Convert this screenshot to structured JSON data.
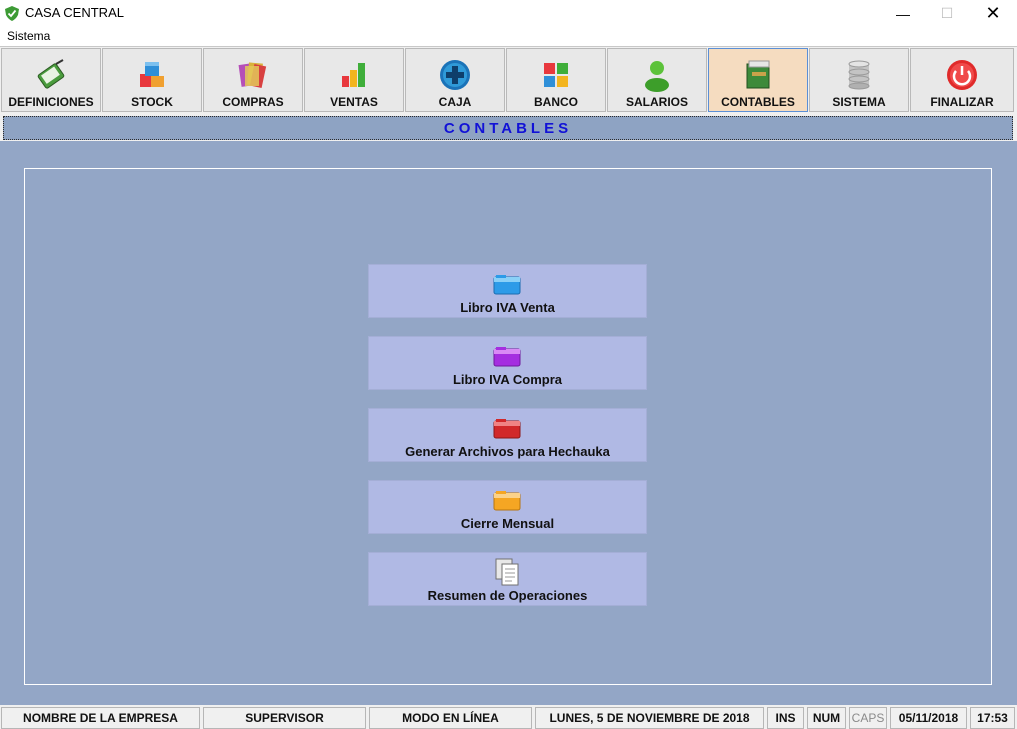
{
  "window": {
    "title": "CASA CENTRAL",
    "minimize": "—",
    "maximize": "☐",
    "close": "✕"
  },
  "menu": {
    "items": [
      {
        "label": "Sistema"
      }
    ]
  },
  "toolbar": {
    "items": [
      {
        "label": "DEFINICIONES",
        "icon": "book-pen-icon"
      },
      {
        "label": "STOCK",
        "icon": "cubes-icon"
      },
      {
        "label": "COMPRAS",
        "icon": "folders-icon"
      },
      {
        "label": "VENTAS",
        "icon": "bar-chart-icon"
      },
      {
        "label": "CAJA",
        "icon": "plus-circle-icon"
      },
      {
        "label": "BANCO",
        "icon": "windows-tiles-icon"
      },
      {
        "label": "SALARIOS",
        "icon": "user-icon"
      },
      {
        "label": "CONTABLES",
        "icon": "ledger-icon",
        "active": true
      },
      {
        "label": "SISTEMA",
        "icon": "database-icon"
      },
      {
        "label": "FINALIZAR",
        "icon": "power-icon"
      }
    ]
  },
  "section": {
    "title": "CONTABLES"
  },
  "actions": [
    {
      "label": "Libro IVA Venta",
      "icon": "folder-blue-icon",
      "color": "#2d9be8"
    },
    {
      "label": "Libro IVA Compra",
      "icon": "folder-purple-icon",
      "color": "#a52ee0"
    },
    {
      "label": "Generar Archivos para Hechauka",
      "icon": "folder-red-icon",
      "color": "#d1282a"
    },
    {
      "label": "Cierre Mensual",
      "icon": "folder-orange-icon",
      "color": "#f5a623"
    },
    {
      "label": "Resumen de Operaciones",
      "icon": "documents-icon"
    }
  ],
  "status": {
    "company": "NOMBRE DE LA EMPRESA",
    "user": "SUPERVISOR",
    "mode": "MODO EN LÍNEA",
    "date_long": "LUNES, 5 DE NOVIEMBRE DE 2018",
    "ins": "INS",
    "num": "NUM",
    "caps": "CAPS",
    "date_short": "05/11/2018",
    "time": "17:53"
  },
  "colors": {
    "content_bg": "#93a6c6",
    "button_bg": "#b0b9e4",
    "header_text": "#1212d6",
    "active_tab": "#f5dcc0"
  }
}
